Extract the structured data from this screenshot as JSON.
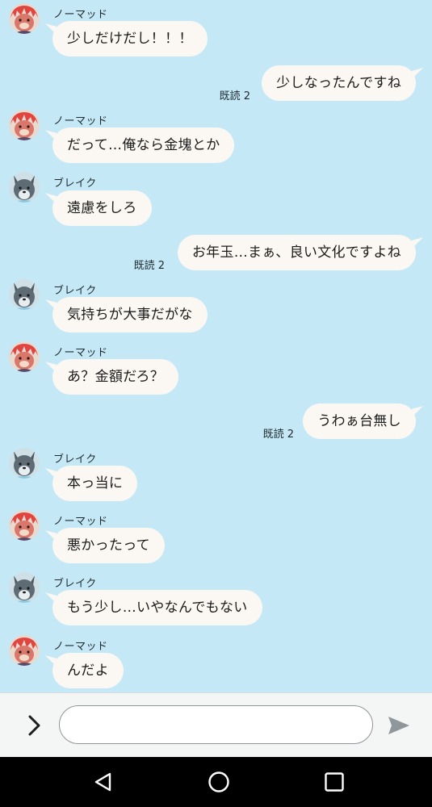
{
  "colors": {
    "background": "#c5e8f6",
    "bubble": "#fbf8f3",
    "send_icon": "#8f979b"
  },
  "senders": {
    "nomad": "ノーマッド",
    "break": "ブレイク"
  },
  "messages": [
    {
      "dir": "in",
      "sender": "ノーマッド",
      "avatar": "nomad-avatar",
      "text": "少しだけだし！！！"
    },
    {
      "dir": "out",
      "text": "少しなったんですね",
      "read": "既読 2"
    },
    {
      "dir": "in",
      "sender": "ノーマッド",
      "avatar": "nomad-avatar",
      "text": "だって…俺なら金塊とか"
    },
    {
      "dir": "in",
      "sender": "ブレイク",
      "avatar": "break-avatar",
      "text": "遠慮をしろ"
    },
    {
      "dir": "out",
      "text": "お年玉…まぁ、良い文化ですよね",
      "read": "既読 2"
    },
    {
      "dir": "in",
      "sender": "ブレイク",
      "avatar": "break-avatar",
      "text": "気持ちが大事だがな"
    },
    {
      "dir": "in",
      "sender": "ノーマッド",
      "avatar": "nomad-avatar",
      "text": "あ？金額だろ？"
    },
    {
      "dir": "out",
      "text": "うわぁ台無し",
      "read": "既読 2"
    },
    {
      "dir": "in",
      "sender": "ブレイク",
      "avatar": "break-avatar",
      "text": "本っ当に"
    },
    {
      "dir": "in",
      "sender": "ノーマッド",
      "avatar": "nomad-avatar",
      "text": "悪かったって"
    },
    {
      "dir": "in",
      "sender": "ブレイク",
      "avatar": "break-avatar",
      "text": "もう少し…いやなんでもない"
    },
    {
      "dir": "in",
      "sender": "ノーマッド",
      "avatar": "nomad-avatar",
      "text": "んだよ"
    }
  ],
  "input": {
    "value": "",
    "placeholder": "",
    "expand_icon": "chevron-right-icon",
    "send_icon": "send-icon"
  },
  "nav": {
    "back_icon": "back-triangle-icon",
    "home_icon": "home-circle-icon",
    "recents_icon": "recents-square-icon"
  }
}
